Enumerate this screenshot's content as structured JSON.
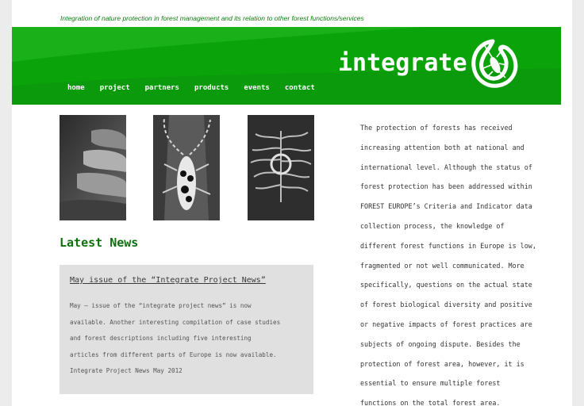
{
  "header": {
    "tagline": "Integration of nature protection in forest management and its relation to other forest functions/services",
    "brand": "integrate",
    "logo_icon": "beetle-in-circle-icon",
    "colors": {
      "banner": "#0aa40a",
      "text_green": "#0f7d0f"
    }
  },
  "nav": {
    "items": [
      {
        "label": "home"
      },
      {
        "label": "project"
      },
      {
        "label": "partners"
      },
      {
        "label": "products"
      },
      {
        "label": "events"
      },
      {
        "label": "contact"
      }
    ]
  },
  "photos": [
    {
      "subject": "bracket-fungus-photo"
    },
    {
      "subject": "longhorn-beetle-photo"
    },
    {
      "subject": "bark-beetle-galleries-photo"
    }
  ],
  "news": {
    "heading": "Latest News",
    "item_title": "May issue of the “Integrate Project News”",
    "body_lines": [
      "May – issue of the “integrate project news” is now",
      "available. Another interesting compilation of case studies",
      "and forest descriptions including five interesting",
      "articles from different parts of Europe is now available.",
      "Integrate Project News May 2012"
    ]
  },
  "intro": {
    "lines": [
      "The protection of forests has received",
      "increasing attention both at national and",
      "international level. Although the status of",
      "forest protection has been addressed within",
      "FOREST EUROPE’s Criteria and Indicator data",
      "collection process, the knowledge of",
      "different forest functions in Europe is low,",
      "fragmented or not well communicated. More",
      "specifically, questions on the actual state",
      "of forest biological diversity and positive",
      "or negative impacts of forest practices are",
      "subjects of ongoing dispute. Besides the",
      "protection of forest area, however, it is",
      "essential to ensure multiple forest",
      "functions on the total forest area."
    ]
  }
}
